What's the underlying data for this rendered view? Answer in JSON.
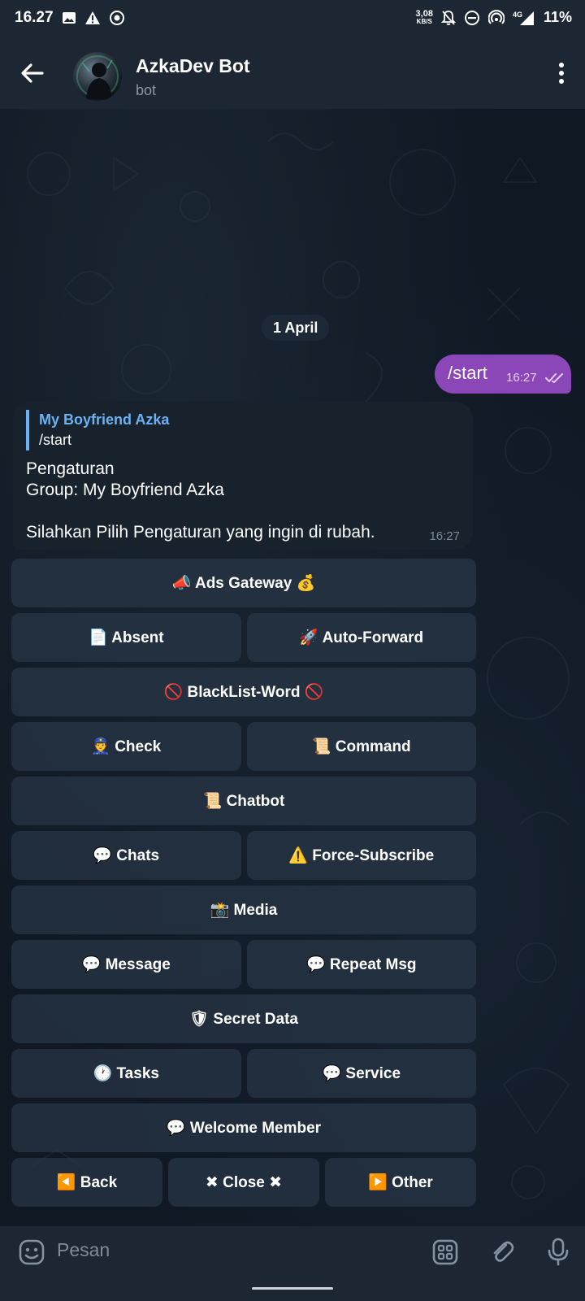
{
  "status_bar": {
    "time": "16.27",
    "speed_value": "3,08",
    "speed_unit": "KB/S",
    "network": "4G",
    "battery": "11%"
  },
  "header": {
    "title": "AzkaDev Bot",
    "subtitle": "bot"
  },
  "chat": {
    "date_label": "1 April",
    "outgoing": {
      "text": "/start",
      "time": "16:27"
    },
    "incoming": {
      "reply_name": "My Boyfriend Azka",
      "reply_text": "/start",
      "lines": [
        "Pengaturan",
        "Group: My Boyfriend Azka",
        "",
        "Silahkan Pilih Pengaturan yang ingin di rubah."
      ],
      "time": "16:27"
    }
  },
  "keyboard": [
    [
      "📣 Ads Gateway 💰"
    ],
    [
      "📄 Absent",
      "🚀 Auto-Forward"
    ],
    [
      "🚫 BlackList-Word 🚫"
    ],
    [
      "👮 Check",
      "📜 Command"
    ],
    [
      "📜 Chatbot"
    ],
    [
      "💬 Chats",
      "⚠️ Force-Subscribe"
    ],
    [
      "📸 Media"
    ],
    [
      "💬 Message",
      "💬 Repeat Msg"
    ],
    [
      "🛡 Secret Data"
    ],
    [
      "🕐 Tasks",
      "💬 Service"
    ],
    [
      "💬 Welcome Member"
    ],
    [
      "◀️ Back",
      "✖ Close ✖",
      "▶️ Other"
    ]
  ],
  "input": {
    "placeholder": "Pesan"
  },
  "colors": {
    "header_bg": "#1c2733",
    "outgoing_bubble": "#8b46b8",
    "incoming_bubble": "#18222d",
    "reply_accent": "#6ab2f2",
    "button_bg": "#283646"
  },
  "icons": {
    "back": "arrow-left-icon",
    "menu": "more-vert-icon",
    "emoji": "emoji-icon",
    "commands": "bot-commands-icon",
    "attach": "paperclip-icon",
    "mic": "microphone-icon"
  }
}
